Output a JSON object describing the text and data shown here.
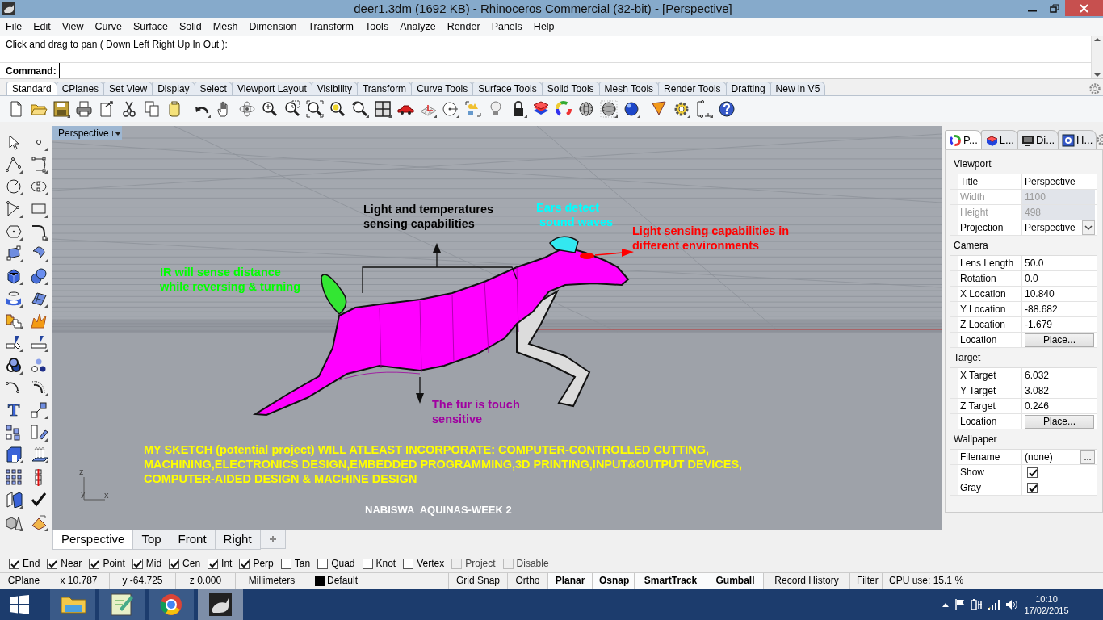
{
  "window": {
    "title": "deer1.3dm (1692 KB) - Rhinoceros Commercial (32-bit) - [Perspective]"
  },
  "menu": [
    "File",
    "Edit",
    "View",
    "Curve",
    "Surface",
    "Solid",
    "Mesh",
    "Dimension",
    "Transform",
    "Tools",
    "Analyze",
    "Render",
    "Panels",
    "Help"
  ],
  "command": {
    "history": "Click and drag to pan ( Down  Left  Right  Up  In  Out ):",
    "prompt": "Command:"
  },
  "toolbar_tabs": [
    {
      "label": "Standard",
      "selected": true
    },
    {
      "label": "CPlanes",
      "selected": false
    },
    {
      "label": "Set View",
      "selected": false
    },
    {
      "label": "Display",
      "selected": false
    },
    {
      "label": "Select",
      "selected": false
    },
    {
      "label": "Viewport Layout",
      "selected": false
    },
    {
      "label": "Visibility",
      "selected": false
    },
    {
      "label": "Transform",
      "selected": false
    },
    {
      "label": "Curve Tools",
      "selected": false
    },
    {
      "label": "Surface Tools",
      "selected": false
    },
    {
      "label": "Solid Tools",
      "selected": false
    },
    {
      "label": "Mesh Tools",
      "selected": false
    },
    {
      "label": "Render Tools",
      "selected": false
    },
    {
      "label": "Drafting",
      "selected": false
    },
    {
      "label": "New in V5",
      "selected": false
    }
  ],
  "left_toolbar": {
    "text_glyph": "T"
  },
  "viewport": {
    "title": "Perspective",
    "axis_labels": [
      "z",
      "y",
      "x"
    ],
    "annotations": [
      {
        "text": "Light and temperatures\nsensing capabilities",
        "color": "#000000"
      },
      {
        "text": "Ears detect\n sound waves",
        "color": "#00ffff"
      },
      {
        "text": "Light sensing capabilities in\ndifferent environments",
        "color": "#ff0000"
      },
      {
        "text": "IR will sense distance\nwhile reversing & turning",
        "color": "#00ff00"
      },
      {
        "text": "The fur is touch\nsensitive",
        "color": "#a000a0"
      },
      {
        "text": "MY SKETCH (potential project) WILL ATLEAST INCORPORATE: COMPUTER-CONTROLLED CUTTING,\nMACHINING,ELECTRONICS DESIGN,EMBEDDED PROGRAMMING,3D PRINTING,INPUT&OUTPUT DEVICES,\nCOMPUTER-AIDED DESIGN & MACHINE DESIGN",
        "color": "#ffff00"
      },
      {
        "text": "NABISWA  AQUINAS-WEEK 2",
        "color": "#ffffff"
      }
    ]
  },
  "viewport_tabs": [
    {
      "label": "Perspective",
      "selected": true
    },
    {
      "label": "Top",
      "selected": false
    },
    {
      "label": "Front",
      "selected": false
    },
    {
      "label": "Right",
      "selected": false
    }
  ],
  "panel": {
    "tabs": [
      {
        "label": "P...",
        "selected": true
      },
      {
        "label": "L...",
        "selected": false
      },
      {
        "label": "Di...",
        "selected": false
      },
      {
        "label": "H...",
        "selected": false
      }
    ],
    "sections": [
      {
        "title": "Viewport",
        "rows": [
          {
            "label": "Title",
            "value": "Perspective",
            "kind": "text",
            "disabled": false
          },
          {
            "label": "Width",
            "value": "1100",
            "kind": "text",
            "disabled": true
          },
          {
            "label": "Height",
            "value": "498",
            "kind": "text",
            "disabled": true
          },
          {
            "label": "Projection",
            "value": "Perspective",
            "kind": "select",
            "disabled": false
          }
        ]
      },
      {
        "title": "Camera",
        "rows": [
          {
            "label": "Lens Length",
            "value": "50.0",
            "kind": "text",
            "disabled": false
          },
          {
            "label": "Rotation",
            "value": "0.0",
            "kind": "text",
            "disabled": false
          },
          {
            "label": "X Location",
            "value": "10.840",
            "kind": "text",
            "disabled": false
          },
          {
            "label": "Y Location",
            "value": "-88.682",
            "kind": "text",
            "disabled": false
          },
          {
            "label": "Z Location",
            "value": "-1.679",
            "kind": "text",
            "disabled": false
          },
          {
            "label": "Location",
            "value": "Place...",
            "kind": "button",
            "disabled": false
          }
        ]
      },
      {
        "title": "Target",
        "rows": [
          {
            "label": "X Target",
            "value": "6.032",
            "kind": "text",
            "disabled": false
          },
          {
            "label": "Y Target",
            "value": "3.082",
            "kind": "text",
            "disabled": false
          },
          {
            "label": "Z Target",
            "value": "0.246",
            "kind": "text",
            "disabled": false
          },
          {
            "label": "Location",
            "value": "Place...",
            "kind": "button",
            "disabled": false
          }
        ]
      },
      {
        "title": "Wallpaper",
        "rows": [
          {
            "label": "Filename",
            "value": "(none)",
            "button": "...",
            "kind": "browse",
            "disabled": false
          },
          {
            "label": "Show",
            "kind": "checkbox",
            "checked": true,
            "disabled": false
          },
          {
            "label": "Gray",
            "kind": "checkbox",
            "checked": true,
            "disabled": false
          }
        ]
      }
    ]
  },
  "osnaps": [
    {
      "label": "End",
      "checked": true,
      "disabled": false
    },
    {
      "label": "Near",
      "checked": true,
      "disabled": false
    },
    {
      "label": "Point",
      "checked": true,
      "disabled": false
    },
    {
      "label": "Mid",
      "checked": true,
      "disabled": false
    },
    {
      "label": "Cen",
      "checked": true,
      "disabled": false
    },
    {
      "label": "Int",
      "checked": true,
      "disabled": false
    },
    {
      "label": "Perp",
      "checked": true,
      "disabled": false
    },
    {
      "label": "Tan",
      "checked": false,
      "disabled": false
    },
    {
      "label": "Quad",
      "checked": false,
      "disabled": false
    },
    {
      "label": "Knot",
      "checked": false,
      "disabled": false
    },
    {
      "label": "Vertex",
      "checked": false,
      "disabled": false
    },
    {
      "label": "Project",
      "checked": false,
      "disabled": true
    },
    {
      "label": "Disable",
      "checked": false,
      "disabled": true
    }
  ],
  "status_bar": {
    "cplane": "CPlane",
    "x": "x 10.787",
    "y": "y -64.725",
    "z": "z 0.000",
    "units": "Millimeters",
    "layer": {
      "name": "Default",
      "color": "#000000"
    },
    "toggles": [
      {
        "label": "Grid Snap",
        "on": false
      },
      {
        "label": "Ortho",
        "on": false
      },
      {
        "label": "Planar",
        "on": true
      },
      {
        "label": "Osnap",
        "on": true
      },
      {
        "label": "SmartTrack",
        "on": true
      },
      {
        "label": "Gumball",
        "on": true
      },
      {
        "label": "Record History",
        "on": false
      },
      {
        "label": "Filter",
        "on": false
      }
    ],
    "cpu": "CPU use: 15.1 %"
  },
  "taskbar": {
    "apps": [
      {
        "selected": false
      },
      {
        "selected": false
      },
      {
        "selected": false
      },
      {
        "selected": true
      }
    ],
    "time": "10:10",
    "date": "17/02/2015"
  }
}
